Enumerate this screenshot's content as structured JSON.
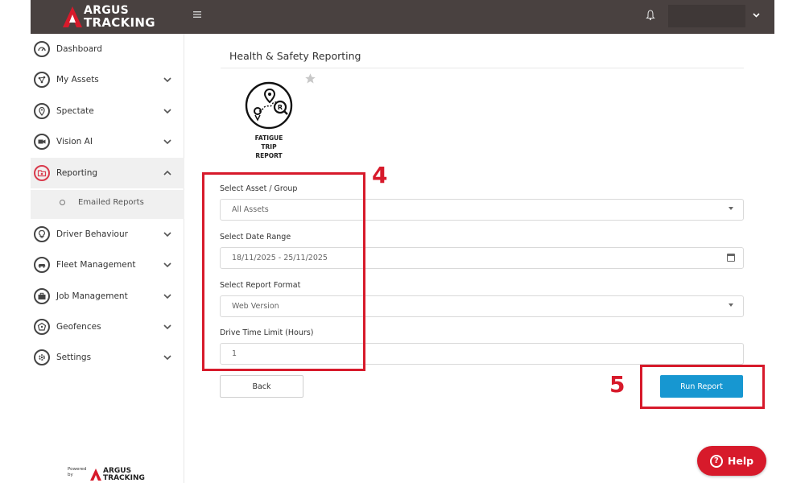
{
  "brand": {
    "line1": "ARGUS",
    "line2": "TRACKING",
    "accent": "#d71a2b"
  },
  "topbar": {
    "menu_icon": "hamburger-icon",
    "notification_icon": "bell-icon",
    "user_menu_icon": "chevron-down-icon"
  },
  "sidebar": {
    "items": [
      {
        "label": "Dashboard",
        "icon": "gauge-icon",
        "has_chevron": false
      },
      {
        "label": "My Assets",
        "icon": "network-icon",
        "has_chevron": true
      },
      {
        "label": "Spectate",
        "icon": "map-pin-icon",
        "has_chevron": true
      },
      {
        "label": "Vision AI",
        "icon": "video-camera-icon",
        "has_chevron": true
      },
      {
        "label": "Reporting",
        "icon": "folder-report-icon",
        "has_chevron": true,
        "expanded": true
      },
      {
        "label": "Driver Behaviour",
        "icon": "lightbulb-icon",
        "has_chevron": true
      },
      {
        "label": "Fleet Management",
        "icon": "car-icon",
        "has_chevron": true
      },
      {
        "label": "Job Management",
        "icon": "briefcase-icon",
        "has_chevron": true
      },
      {
        "label": "Geofences",
        "icon": "geofence-icon",
        "has_chevron": true
      },
      {
        "label": "Settings",
        "icon": "gear-icon",
        "has_chevron": true
      }
    ],
    "sub_items": [
      {
        "label": "Emailed Reports"
      }
    ],
    "powered": {
      "small": "Powered by",
      "line1": "ARGUS",
      "line2": "TRACKING"
    }
  },
  "page": {
    "title": "Health & Safety Reporting",
    "report_tile": {
      "caption_line1": "FATIGUE",
      "caption_line2": "TRIP",
      "caption_line3": "REPORT",
      "icon": "fatigue-trip-route-icon"
    },
    "favorite_icon": "star-icon"
  },
  "form": {
    "asset": {
      "label": "Select Asset / Group",
      "value": "All Assets"
    },
    "date_range": {
      "label": "Select Date Range",
      "value": "18/11/2025 - 25/11/2025"
    },
    "format": {
      "label": "Select Report Format",
      "value": "Web Version"
    },
    "drive_limit": {
      "label": "Drive Time Limit (Hours)",
      "value": "1"
    }
  },
  "buttons": {
    "back": "Back",
    "run": "Run Report"
  },
  "annotations": {
    "step4": "4",
    "step5": "5",
    "color": "#d71a2b"
  },
  "help": {
    "label": "Help"
  }
}
